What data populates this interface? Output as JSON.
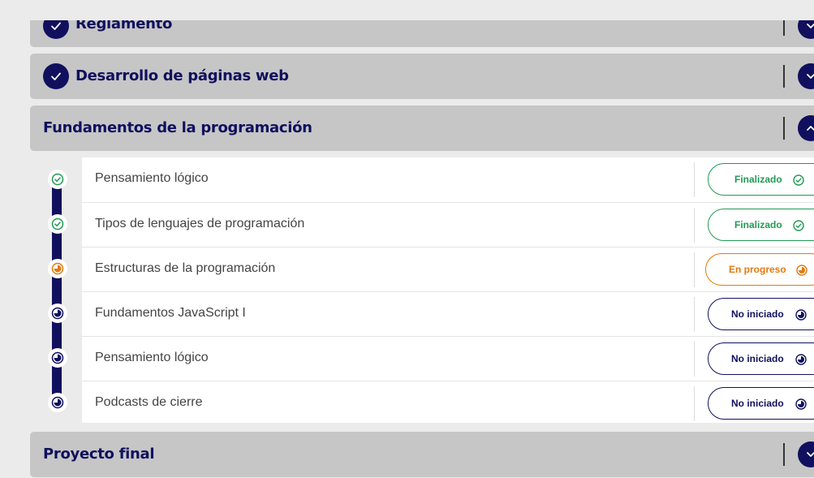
{
  "colors": {
    "navy": "#10105e",
    "section_bg": "#c6c6c6",
    "completed": "#1f9a55",
    "in_progress": "#e07a10",
    "not_started": "#10105e"
  },
  "sections": [
    {
      "title": "Reglamento",
      "completed": true,
      "expanded": false
    },
    {
      "title": "Desarrollo de páginas web",
      "completed": true,
      "expanded": false
    },
    {
      "title": "Fundamentos de la programación",
      "completed": false,
      "expanded": true
    },
    {
      "title": "Proyecto final",
      "completed": false,
      "expanded": false
    }
  ],
  "lessons": [
    {
      "label": "Pensamiento lógico",
      "status": "Finalizado",
      "state": "completed",
      "icon": "check-circle-icon"
    },
    {
      "label": "Tipos de lenguajes de programación",
      "status": "Finalizado",
      "state": "completed",
      "icon": "check-circle-icon"
    },
    {
      "label": "Estructuras de la programación",
      "status": "En progreso",
      "state": "in_progress",
      "icon": "progress-clock-icon"
    },
    {
      "label": "Fundamentos JavaScript I",
      "status": "No iniciado",
      "state": "not_started",
      "icon": "progress-clock-icon"
    },
    {
      "label": "Pensamiento lógico",
      "status": "No iniciado",
      "state": "not_started",
      "icon": "progress-clock-icon"
    },
    {
      "label": "Podcasts de cierre",
      "status": "No iniciado",
      "state": "not_started",
      "icon": "progress-clock-icon"
    }
  ]
}
